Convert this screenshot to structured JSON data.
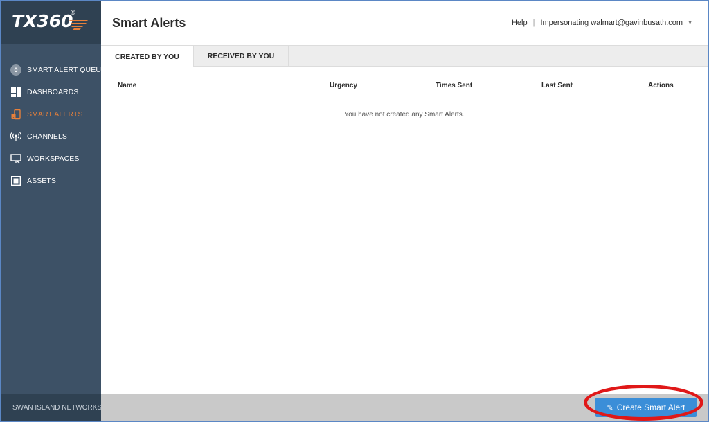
{
  "app": {
    "logo_text": "TX360",
    "logo_reg": "®",
    "footer_brand": "SWAN ISLAND NETWORKS"
  },
  "sidebar": {
    "items": [
      {
        "label": "SMART ALERT QUEUE",
        "icon": "queue-count-badge",
        "badge": "0",
        "active": false
      },
      {
        "label": "DASHBOARDS",
        "icon": "dashboard-grid-icon",
        "active": false
      },
      {
        "label": "SMART ALERTS",
        "icon": "smart-alerts-icon",
        "active": true
      },
      {
        "label": "CHANNELS",
        "icon": "broadcast-antenna-icon",
        "active": false
      },
      {
        "label": "WORKSPACES",
        "icon": "monitor-icon",
        "active": false
      },
      {
        "label": "ASSETS",
        "icon": "asset-box-icon",
        "active": false
      }
    ]
  },
  "header": {
    "title": "Smart Alerts",
    "help": "Help",
    "separator": "|",
    "impersonating": "Impersonating walmart@gavinbusath.com",
    "caret": "▼"
  },
  "tabs": [
    {
      "label": "CREATED BY YOU",
      "active": true
    },
    {
      "label": "RECEIVED BY YOU",
      "active": false
    }
  ],
  "table": {
    "columns": [
      "Name",
      "Urgency",
      "Times Sent",
      "Last Sent",
      "Actions"
    ],
    "rows": [],
    "empty_message": "You have not created any Smart Alerts."
  },
  "footer": {
    "create_button": "Create Smart Alert",
    "create_icon": "pencil-icon"
  },
  "colors": {
    "sidebar_bg": "#3d5166",
    "active_nav": "#e8803a",
    "primary_button": "#3b8ed8",
    "annotation_ring": "#e01818"
  }
}
